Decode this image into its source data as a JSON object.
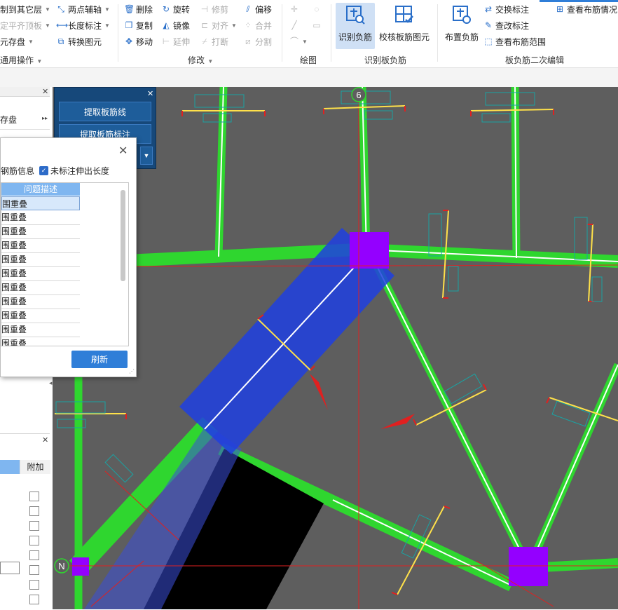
{
  "ribbon": {
    "common_ops": {
      "copy_to_layer": "制到其它层",
      "align_top": "定平齐顶板",
      "save_element": "元存盘",
      "two_point_axis": "两点辅轴",
      "length_label": "长度标注",
      "convert_element": "转换图元",
      "group_label": "通用操作"
    },
    "modify": {
      "delete": "删除",
      "rotate": "旋转",
      "trim": "修剪",
      "offset": "偏移",
      "copy": "复制",
      "mirror": "镜像",
      "align": "对齐",
      "merge": "合并",
      "move": "移动",
      "extend": "延伸",
      "break": "打断",
      "split": "分割",
      "group_label": "修改"
    },
    "draw": {
      "group_label": "绘图"
    },
    "identify": {
      "identify_neg_rebar": "识别负筋",
      "check_element": "校核板筋图元",
      "group_label": "识别板负筋"
    },
    "secondary": {
      "place_neg_rebar": "布置负筋",
      "swap_label": "交换标注",
      "edit_label": "查改标注",
      "view_range": "查看布筋范围",
      "view_layout": "查看布筋情况",
      "group_label": "板负筋二次编辑"
    }
  },
  "left_panel": {
    "save_label": "存盘"
  },
  "float_panel": {
    "extract_lines": "提取板筋线",
    "extract_labels": "提取板筋标注"
  },
  "dialog": {
    "opt1_label": "钢筋信息",
    "opt2_label": "未标注伸出长度",
    "opt2_checked": true,
    "column_header": "问题描述",
    "rows": [
      "范围重叠",
      "范围重叠",
      "范围重叠",
      "范围重叠",
      "范围重叠",
      "范围重叠",
      "范围重叠",
      "范围重叠",
      "范围重叠",
      "范围重叠",
      "范围重叠"
    ],
    "refresh": "刷新"
  },
  "lower_panel": {
    "col_label": "附加"
  },
  "canvas": {
    "axis_top": "6",
    "axis_left": "N",
    "colors": {
      "background": "#5e5e5e",
      "beam": "#2fd62f",
      "selection": "#1f3fe0",
      "column": "#9400ff",
      "rebar": "#ffe14a",
      "annotation": "#1aa3a3",
      "axis": "#e02020"
    }
  }
}
